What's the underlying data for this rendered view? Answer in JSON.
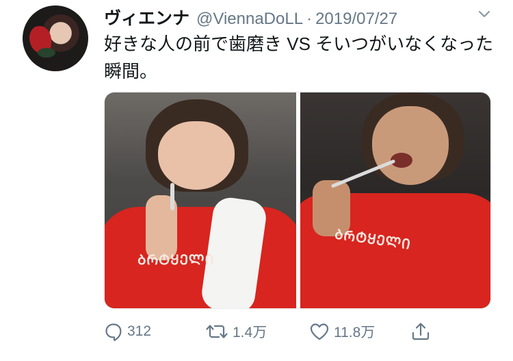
{
  "tweet": {
    "display_name": "ヴィエンナ",
    "handle": "@ViennaDoLL",
    "separator": "·",
    "date": "2019/07/27",
    "text": "好きな人の前で歯磨き VS そいつがいなくなった瞬間。",
    "shirt_print": "ᲑᲠᲢᲧᲔᲚᲘ",
    "actions": {
      "reply_count": "312",
      "retweet_count": "1.4万",
      "like_count": "11.8万"
    }
  },
  "colors": {
    "text": "#14171a",
    "secondary": "#657786",
    "shirt_red": "#d8251f"
  },
  "icons": [
    "chevron-down-icon",
    "reply-icon",
    "retweet-icon",
    "heart-icon",
    "share-icon"
  ]
}
